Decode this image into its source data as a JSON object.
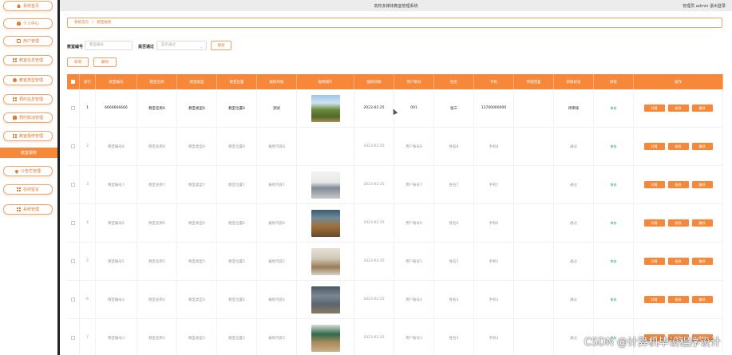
{
  "header": {
    "title": "高校多媒体教室管理系统",
    "user_info": "管理员 admin  退出登录"
  },
  "sidebar": {
    "items": [
      {
        "label": "系统首页",
        "icon": "home-icon"
      },
      {
        "label": "个人中心",
        "icon": "user-icon"
      },
      {
        "label": "用户管理",
        "icon": "message-icon"
      },
      {
        "label": "教室信息管理",
        "icon": "grid-icon"
      },
      {
        "label": "教室类型管理",
        "icon": "gear-icon"
      },
      {
        "label": "预约信息管理",
        "icon": "grid-icon"
      },
      {
        "label": "预约取消管理",
        "icon": "doc-icon"
      },
      {
        "label": "教室报修管理",
        "icon": "grid-icon"
      },
      {
        "label": "教室报修",
        "icon": ""
      },
      {
        "label": "公告栏管理",
        "icon": "pin-icon"
      },
      {
        "label": "在线留言",
        "icon": "grid-icon"
      },
      {
        "label": "系统管理",
        "icon": "grid-icon"
      }
    ]
  },
  "breadcrumb": {
    "home": "系统首页",
    "separator": "/",
    "current": "教室报修"
  },
  "search": {
    "field1_label": "教室编号",
    "field1_placeholder": "教室编号",
    "field2_label": "是否通过",
    "field2_placeholder": "是否通过",
    "search_button": "搜索"
  },
  "actions": {
    "add": "新增",
    "delete": "删除"
  },
  "table": {
    "columns": [
      "",
      "索引",
      "教室编号",
      "教室名称",
      "教室类型",
      "教室位置",
      "报修内容",
      "报修图片",
      "报修日期",
      "用户账号",
      "姓名",
      "手机",
      "审核回复",
      "审核状态",
      "审核",
      "操作"
    ],
    "rows": [
      {
        "index": "1",
        "code": "6666666666",
        "name": "教室名称6",
        "type": "教室类型6",
        "location": "教室位置6",
        "content": "测试",
        "image": "photo-forest",
        "date": "2023-02-25",
        "account": "001",
        "realname": "张三",
        "phone": "13700000000",
        "reply": "",
        "review_status": "待审核",
        "review": "审核"
      },
      {
        "index": "2",
        "code": "教室编号8",
        "name": "教室名称8",
        "type": "教室类型8",
        "location": "教室位置8",
        "content": "报修内容8",
        "image": "photo-none",
        "date": "2023-02-25",
        "account": "用户账号8",
        "realname": "姓名8",
        "phone": "手机8",
        "reply": "",
        "review_status": "通过",
        "review": "审核"
      },
      {
        "index": "3",
        "code": "教室编号7",
        "name": "教室名称7",
        "type": "教室类型7",
        "location": "教室位置7",
        "content": "报修内容7",
        "image": "photo-classroom-white",
        "date": "2023-02-25",
        "account": "用户账号7",
        "realname": "姓名7",
        "phone": "手机7",
        "reply": "",
        "review_status": "通过",
        "review": "审核"
      },
      {
        "index": "4",
        "code": "教室编号6",
        "name": "教室名称6",
        "type": "教室类型6",
        "location": "教室位置6",
        "content": "报修内容6",
        "image": "photo-classroom-students",
        "date": "2023-02-25",
        "account": "用户账号6",
        "realname": "姓名6",
        "phone": "手机6",
        "reply": "",
        "review_status": "通过",
        "review": "审核"
      },
      {
        "index": "5",
        "code": "教室编号5",
        "name": "教室名称5",
        "type": "教室类型5",
        "location": "教室位置5",
        "content": "报修内容5",
        "image": "photo-classroom-wood",
        "date": "2023-02-25",
        "account": "用户账号5",
        "realname": "姓名5",
        "phone": "手机5",
        "reply": "",
        "review_status": "通过",
        "review": "审核"
      },
      {
        "index": "6",
        "code": "教室编号4",
        "name": "教室名称4",
        "type": "教室类型4",
        "location": "教室位置4",
        "content": "报修内容4",
        "image": "photo-classroom-dark",
        "date": "2023-02-25",
        "account": "用户账号4",
        "realname": "姓名4",
        "phone": "手机4",
        "reply": "",
        "review_status": "通过",
        "review": "审核"
      },
      {
        "index": "7",
        "code": "教室编号3",
        "name": "教室名称3",
        "type": "教室类型3",
        "location": "教室位置3",
        "content": "报修内容3",
        "image": "photo-classroom-green",
        "date": "2023-02-25",
        "account": "用户账号3",
        "realname": "姓名3",
        "phone": "手机3",
        "reply": "",
        "review_status": "通过",
        "review": "审核"
      }
    ],
    "row_buttons": {
      "detail": "详情",
      "edit": "修改",
      "delete": "删除"
    }
  },
  "watermark": "CSDN @计算机毕设程序设计",
  "colors": {
    "accent": "#f7883a",
    "accent_text": "#e07a35",
    "status_green": "#2aa27a"
  }
}
